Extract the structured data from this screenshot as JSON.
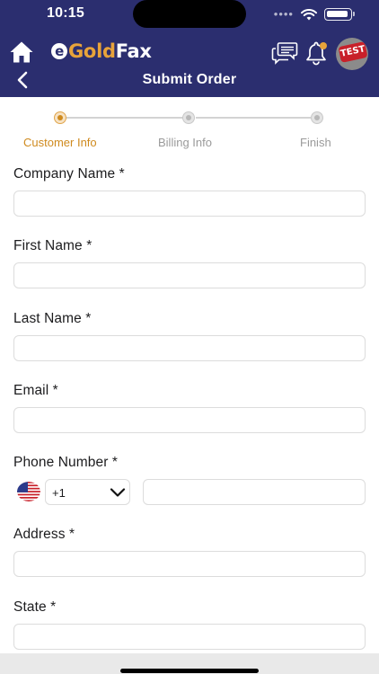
{
  "status_bar": {
    "time": "10:15",
    "signal": "••••"
  },
  "header": {
    "logo_e": "e",
    "logo_gold": "Gold",
    "logo_fax": "Fax",
    "avatar_stamp": "TEST",
    "title": "Submit Order",
    "icons": [
      "home-icon",
      "chat-icon",
      "bell-icon",
      "back-icon"
    ]
  },
  "stepper": {
    "steps": [
      {
        "label": "Customer Info",
        "active": true
      },
      {
        "label": "Billing Info",
        "active": false
      },
      {
        "label": "Finish",
        "active": false
      }
    ]
  },
  "form": {
    "company_name": {
      "label": "Company Name *",
      "value": ""
    },
    "first_name": {
      "label": "First Name *",
      "value": ""
    },
    "last_name": {
      "label": "Last Name *",
      "value": ""
    },
    "email": {
      "label": "Email *",
      "value": ""
    },
    "phone": {
      "label": "Phone Number *",
      "country_code": "+1",
      "flag": "us-flag-icon",
      "value": ""
    },
    "address": {
      "label": "Address *",
      "value": ""
    },
    "state": {
      "label": "State *",
      "value": ""
    }
  },
  "colors": {
    "header_bg": "#2b2e6f",
    "accent": "#cf8a1e",
    "logo_gold": "#e8a33a"
  }
}
